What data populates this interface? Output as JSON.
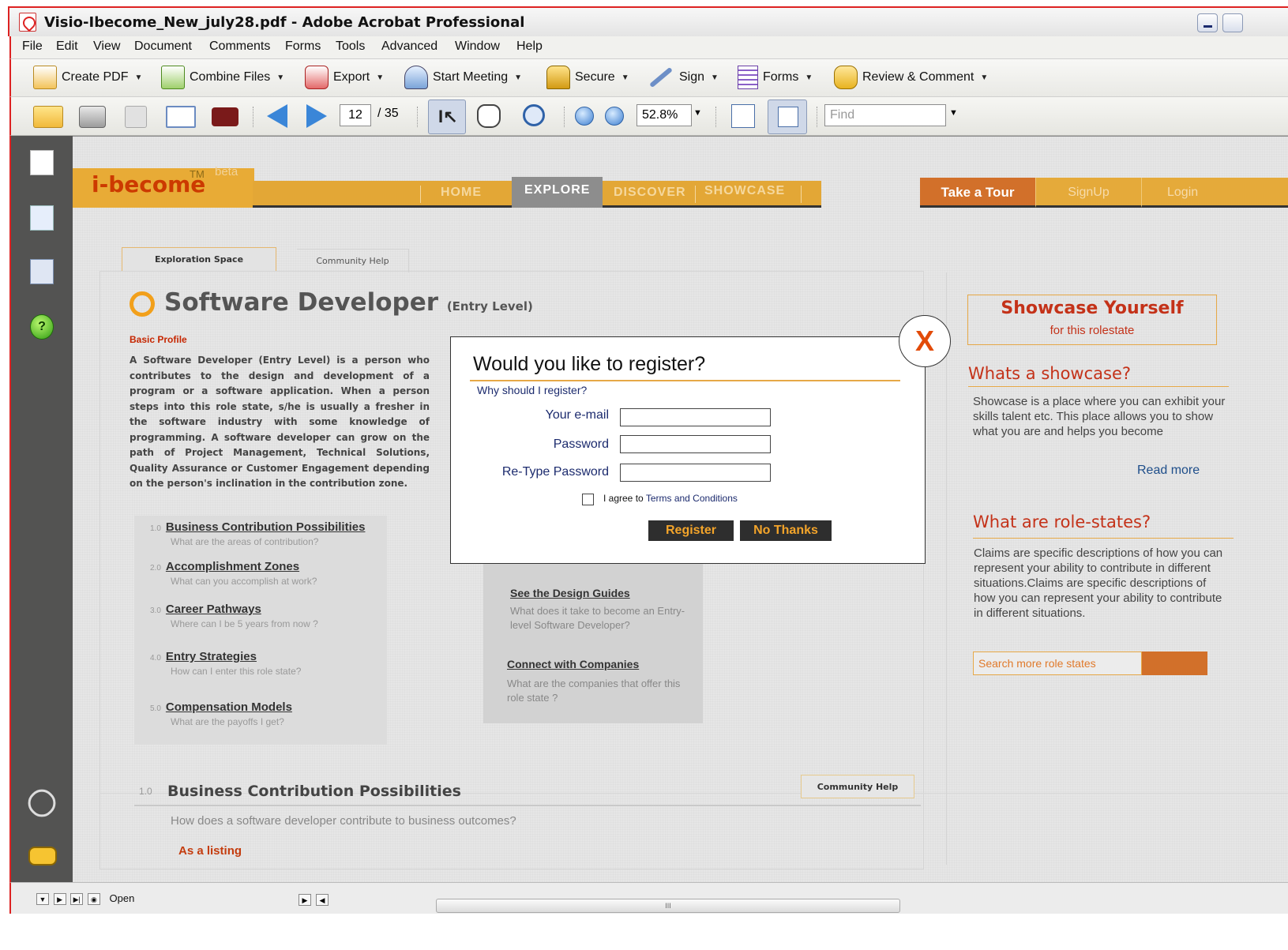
{
  "window": {
    "title": "Visio-Ibecome_New_july28.pdf - Adobe Acrobat Professional"
  },
  "menubar": [
    "File",
    "Edit",
    "View",
    "Document",
    "Comments",
    "Forms",
    "Tools",
    "Advanced",
    "Window",
    "Help"
  ],
  "toolbar1": {
    "create_pdf": "Create PDF",
    "combine_files": "Combine Files",
    "export": "Export",
    "start_meeting": "Start Meeting",
    "secure": "Secure",
    "sign": "Sign",
    "forms": "Forms",
    "review_comment": "Review & Comment"
  },
  "toolbar2": {
    "current_page": "12",
    "total_pages": "/ 35",
    "zoom": "52.8%",
    "find_placeholder": "Find"
  },
  "site": {
    "logo": "i-become",
    "tm": "TM",
    "beta": "beta",
    "nav": [
      "HOME",
      "EXPLORE",
      "DISCOVER",
      "SHOWCASE"
    ],
    "active_nav": "EXPLORE",
    "take_tour": "Take a Tour",
    "signup": "SignUp",
    "login": "Login"
  },
  "tabs": {
    "exploration": "Exploration Space",
    "community": "Community Help"
  },
  "profile": {
    "title": "Software Developer",
    "level": "(Entry Level)",
    "basic_label": "Basic Profile",
    "description": "A Software Developer (Entry Level) is a person who contributes to the design and development of a program or a software application. When a person steps into this role state, s/he is usually a fresher in the software industry with some knowledge of programming. A software developer can grow on the path of Project Management, Technical Solutions, Quality Assurance or Customer Engagement depending on the person's inclination in the contribution zone."
  },
  "contributions": [
    {
      "num": "1.0",
      "title": "Business Contribution Possibilities",
      "sub": "What are the areas of contribution?"
    },
    {
      "num": "2.0",
      "title": "Accomplishment Zones",
      "sub": "What can you accomplish at work?"
    },
    {
      "num": "3.0",
      "title": "Career Pathways",
      "sub": "Where can I be 5 years from now ?"
    },
    {
      "num": "4.0",
      "title": "Entry Strategies",
      "sub": "How can I enter this role state?"
    },
    {
      "num": "5.0",
      "title": "Compensation Models",
      "sub": "What are the payoffs I get?"
    }
  ],
  "guides": [
    {
      "title": "See the Design Guides",
      "sub": "What does it take to become an Entry-level Software Developer?"
    },
    {
      "title": "Connect with Companies",
      "sub": "What are the companies that offer this role state ?"
    }
  ],
  "section": {
    "num": "1.0",
    "title": "Business Contribution  Possibilities",
    "community_help": "Community Help",
    "question": "How does a software developer contribute to business outcomes?",
    "listing": "As a listing"
  },
  "right": {
    "showcase_title": "Showcase Yourself",
    "showcase_sub": "for this rolestate",
    "whats_showcase": "Whats a showcase?",
    "showcase_text": "Showcase is a place where you can exhibit your skills talent etc. This place allows you to show what you are and helps you become",
    "read_more": "Read more",
    "role_states_title": "What are role-states?",
    "role_states_text": "Claims are specific descriptions of how you can represent your ability to contribute in different situations.Claims are specific descriptions of how you can represent your ability to contribute in different situations.",
    "search_placeholder": "Search more role states"
  },
  "modal": {
    "close": "X",
    "title": "Would you like to register?",
    "why": "Why should I register?",
    "email_label": "Your e-mail",
    "password_label": "Password",
    "retype_label": "Re-Type Password",
    "agree_prefix": "I agree to",
    "agree_link": "Terms and Conditions",
    "register": "Register",
    "no_thanks": "No Thanks"
  },
  "statusbar": {
    "open": "Open",
    "scroll_grip": "III"
  },
  "colors": {
    "accent_orange": "#e3a736",
    "tour_orange": "#d2702a",
    "heading_red": "#c43219",
    "acrobat_red": "#d22222"
  }
}
